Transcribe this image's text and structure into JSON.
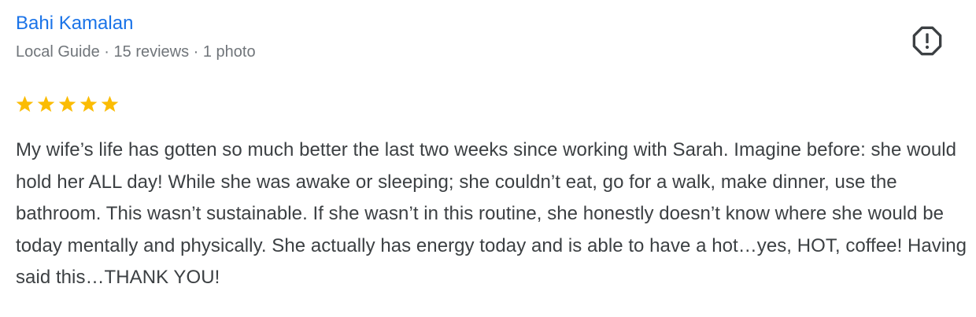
{
  "reviewer": {
    "name": "Bahi Kamalan",
    "meta": "Local Guide · 15 reviews · 1 photo"
  },
  "rating": {
    "stars": 5,
    "max": 5,
    "color": "#fbbc04"
  },
  "report": {
    "icon": "report-flag-icon"
  },
  "review": {
    "text": "My wife’s life has gotten so much better the last two weeks since working with Sarah. Imagine before: she would hold her ALL day! While she was awake or sleeping; she couldn’t eat, go for a walk, make dinner, use the bathroom. This wasn’t sustainable. If she wasn’t in this routine, she honestly doesn’t know where she would be today mentally and physically. She actually has energy today and is able to have a hot…yes, HOT, coffee! Having said this…THANK YOU!"
  },
  "colors": {
    "name": "#1a73e8",
    "meta": "#70757a",
    "text": "#3c4043",
    "icon": "#3c4043"
  }
}
